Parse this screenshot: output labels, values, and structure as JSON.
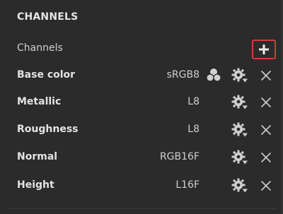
{
  "panel": {
    "title": "CHANNELS",
    "channels_label": "Channels",
    "add_button_icon": "plus-icon"
  },
  "channels": [
    {
      "name": "Base color",
      "format": "sRGB8",
      "has_palette": true
    },
    {
      "name": "Metallic",
      "format": "L8",
      "has_palette": false
    },
    {
      "name": "Roughness",
      "format": "L8",
      "has_palette": false
    },
    {
      "name": "Normal",
      "format": "RGB16F",
      "has_palette": false
    },
    {
      "name": "Height",
      "format": "L16F",
      "has_palette": false
    }
  ],
  "colors": {
    "background": "#2b2b2b",
    "text": "#e3e3e3",
    "highlight_border": "#d63b3b"
  }
}
